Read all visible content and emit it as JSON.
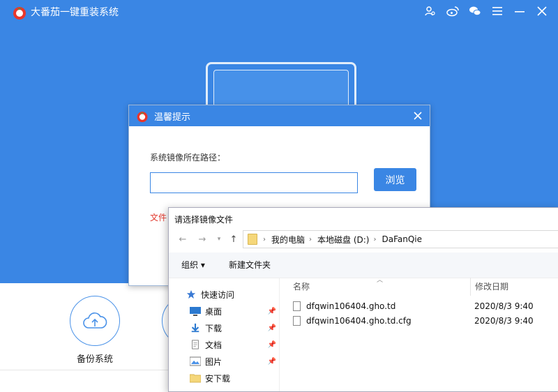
{
  "app": {
    "title": "大番茄一键重装系统",
    "colors": {
      "primary": "#3a86e4",
      "warning": "#e23a2e"
    },
    "titlebar_icons": [
      "user-search-icon",
      "weibo-icon",
      "wechat-icon",
      "menu-icon",
      "minimize-icon",
      "close-icon"
    ],
    "features": [
      {
        "label": "备份系统",
        "icon": "cloud-upload-icon"
      }
    ]
  },
  "dialog": {
    "title": "温馨提示",
    "path_label": "系统镜像所在路径：",
    "path_value": "",
    "browse_label": "浏览",
    "file_hint": "文件"
  },
  "file_picker": {
    "title": "请选择镜像文件",
    "address": [
      "我的电脑",
      "本地磁盘 (D:)",
      "DaFanQie"
    ],
    "toolbar": {
      "organize": "组织 ▾",
      "new_folder": "新建文件夹"
    },
    "quick_access": "快速访问",
    "sidebar": [
      {
        "label": "桌面",
        "icon": "desktop-icon",
        "pinned": true
      },
      {
        "label": "下载",
        "icon": "download-icon",
        "pinned": true
      },
      {
        "label": "文档",
        "icon": "document-icon",
        "pinned": true
      },
      {
        "label": "图片",
        "icon": "picture-icon",
        "pinned": true
      },
      {
        "label": "安下载",
        "icon": "folder-icon",
        "pinned": false
      }
    ],
    "columns": {
      "name": "名称",
      "modified": "修改日期"
    },
    "files": [
      {
        "name": "dfqwin106404.gho.td",
        "modified": "2020/8/3 9:40"
      },
      {
        "name": "dfqwin106404.gho.td.cfg",
        "modified": "2020/8/3 9:40"
      }
    ]
  }
}
